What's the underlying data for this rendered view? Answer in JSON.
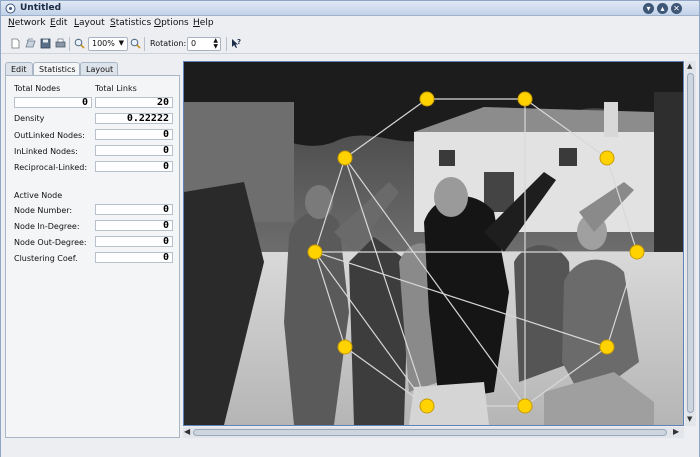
{
  "window": {
    "title": "Untitled"
  },
  "menu": {
    "items": [
      {
        "name": "Network",
        "u": "N",
        "rest": "etwork"
      },
      {
        "name": "Edit",
        "u": "E",
        "rest": "dit"
      },
      {
        "name": "Layout",
        "u": "L",
        "rest": "ayout"
      },
      {
        "name": "Statistics",
        "u": "S",
        "rest": "tatistics"
      },
      {
        "name": "Options",
        "u": "O",
        "rest": "ptions"
      },
      {
        "name": "Help",
        "u": "H",
        "rest": "elp"
      }
    ]
  },
  "toolbar": {
    "zoom_value": "100%",
    "rotation_label": "Rotation:",
    "rotation_value": "0"
  },
  "tabs": {
    "edit": "Edit",
    "statistics": "Statistics",
    "layout": "Layout"
  },
  "stats": {
    "total_nodes_label": "Total Nodes",
    "total_links_label": "Total Links",
    "total_nodes": "0",
    "total_links": "20",
    "density_label": "Density",
    "density": "0.22222",
    "outlinked_label": "OutLinked Nodes:",
    "outlinked": "0",
    "inlinked_label": "InLinked Nodes:",
    "inlinked": "0",
    "reciprocal_label": "Reciprocal-Linked:",
    "reciprocal": "0",
    "active_node_label": "Active Node",
    "node_number_label": "Node Number:",
    "node_number": "0",
    "node_in_label": "Node In-Degree:",
    "node_in": "0",
    "node_out_label": "Node Out-Degree:",
    "node_out": "0",
    "clustering_label": "Clustering Coef.",
    "clustering": "0"
  },
  "icons": [
    "app-icon",
    "new-icon",
    "open-icon",
    "save-icon",
    "print-icon",
    "zoom-in-icon",
    "zoom-out-icon",
    "whats-this-icon",
    "minimize-icon",
    "close-icon"
  ],
  "colors": {
    "node": "#ffd200",
    "node_stroke": "#c89b00",
    "edge": "#d8d8d8",
    "canvas_border": "#5f83b8"
  }
}
